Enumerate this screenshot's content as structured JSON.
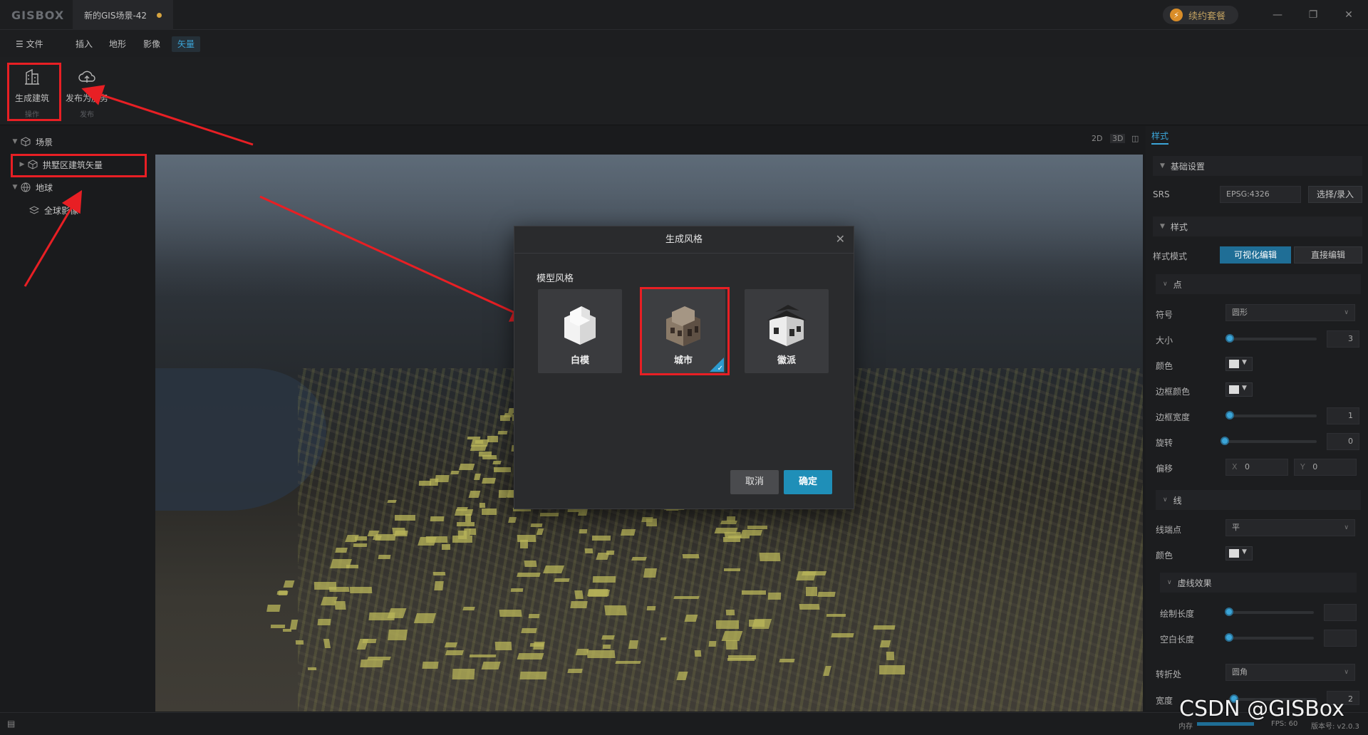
{
  "titlebar": {
    "logo": "GISBOX",
    "doc_tab": "新的GIS场景-42",
    "renew_label": "续约套餐"
  },
  "menubar": {
    "file": "文件",
    "items": [
      "插入",
      "地形",
      "影像",
      "矢量"
    ],
    "active": "矢量"
  },
  "ribbon": {
    "generate_building": "生成建筑",
    "operate_group": "操作",
    "publish_service": "发布为服务",
    "publish_group": "发布"
  },
  "sidebar": {
    "scene": "场景",
    "vector_layer": "拱墅区建筑矢量",
    "earth": "地球",
    "global_imagery": "全球影像"
  },
  "view_tools": [
    "2D",
    "3D"
  ],
  "right_panel": {
    "tab": "样式",
    "basic_settings": "基础设置",
    "srs_label": "SRS",
    "srs_value": "EPSG:4326",
    "srs_button": "选择/录入",
    "style_section": "样式",
    "style_mode_label": "样式模式",
    "visual_edit": "可视化编辑",
    "direct_edit": "直接编辑",
    "point_section": "点",
    "symbol_label": "符号",
    "symbol_value": "圆形",
    "size_label": "大小",
    "size_value": "3",
    "color_label": "颜色",
    "border_color_label": "边框颜色",
    "border_width_label": "边框宽度",
    "border_width_value": "1",
    "rotate_label": "旋转",
    "rotate_value": "0",
    "offset_label": "偏移",
    "offset_x_label": "X",
    "offset_x": "0",
    "offset_y_label": "Y",
    "offset_y": "0",
    "line_section": "线",
    "line_cap_label": "线端点",
    "line_cap_value": "平",
    "line_color_label": "颜色",
    "dash_section": "虚线效果",
    "dash_length_label": "绘制长度",
    "gap_length_label": "空白长度",
    "join_label": "转折处",
    "join_value": "圆角",
    "width_label": "宽度",
    "width_value": "2"
  },
  "status": {
    "memory": "内存",
    "fps": "FPS: 60",
    "version": "版本号: v2.0.3"
  },
  "dialog": {
    "title": "生成风格",
    "subtitle": "模型风格",
    "options": [
      "白模",
      "城市",
      "徽派"
    ],
    "selected": "城市",
    "cancel": "取消",
    "confirm": "确定"
  },
  "watermark": "CSDN @GISBox",
  "colors": {
    "accent": "#3ba5d8",
    "primary_button": "#1f8fb8",
    "annotation_red": "#e81f24",
    "building_highlight": "#b9b55a"
  }
}
